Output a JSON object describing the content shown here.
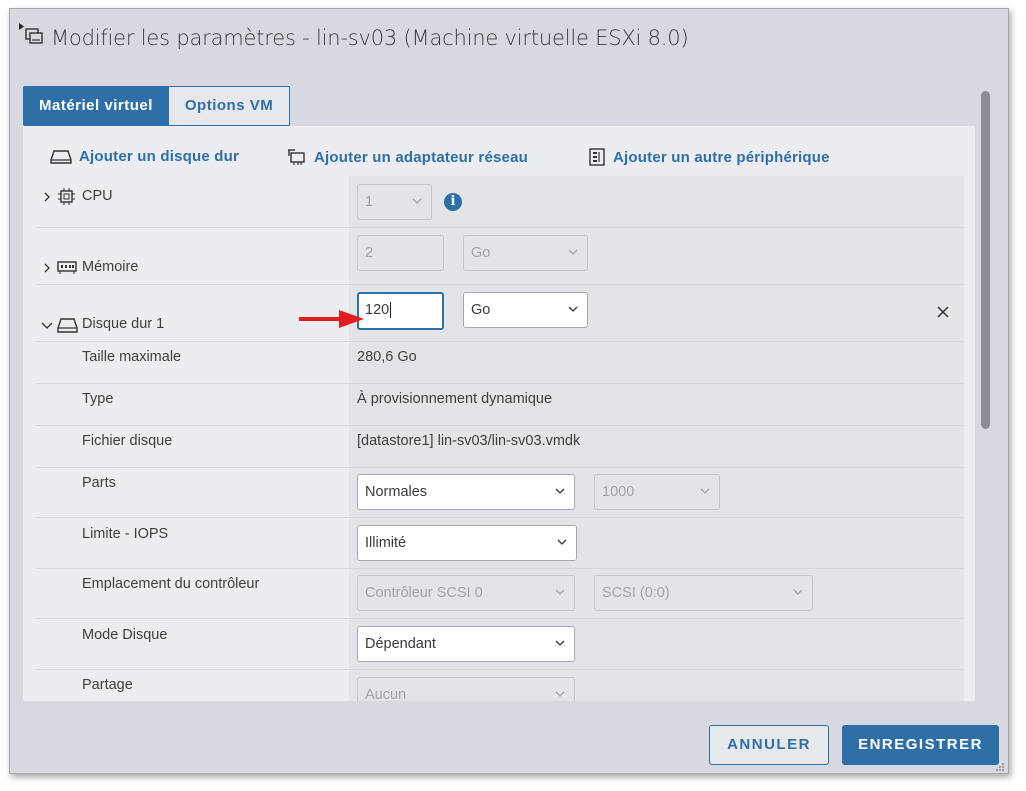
{
  "dialog": {
    "title": "Modifier les paramètres - lin-sv03 (Machine virtuelle ESXi 8.0)"
  },
  "tabs": [
    {
      "label": "Matériel virtuel",
      "active": true
    },
    {
      "label": "Options VM",
      "active": false
    }
  ],
  "actions": {
    "add_disk": "Ajouter un disque dur",
    "add_network": "Ajouter un adaptateur réseau",
    "add_other": "Ajouter un autre périphérique"
  },
  "cpu": {
    "label": "CPU",
    "value": "1"
  },
  "memory": {
    "label": "Mémoire",
    "value": "2",
    "unit": "Go"
  },
  "disk": {
    "label": "Disque dur 1",
    "size_value": "120",
    "size_unit": "Go",
    "max_size_label": "Taille maximale",
    "max_size_value": "280,6 Go",
    "type_label": "Type",
    "type_value": "À provisionnement dynamique",
    "file_label": "Fichier disque",
    "file_value": "[datastore1] lin-sv03/lin-sv03.vmdk",
    "shares_label": "Parts",
    "shares_value": "Normales",
    "shares_number": "1000",
    "iops_label": "Limite - IOPS",
    "iops_value": "Illimité",
    "controller_label": "Emplacement du contrôleur",
    "controller_value": "Contrôleur SCSI 0",
    "controller_slot": "SCSI (0:0)",
    "mode_label": "Mode Disque",
    "mode_value": "Dépendant",
    "sharing_label": "Partage",
    "sharing_value": "Aucun"
  },
  "footer": {
    "cancel": "ANNULER",
    "save": "ENREGISTRER"
  },
  "colors": {
    "accent": "#2f6fa7",
    "annotation_arrow": "#e11d1d"
  }
}
